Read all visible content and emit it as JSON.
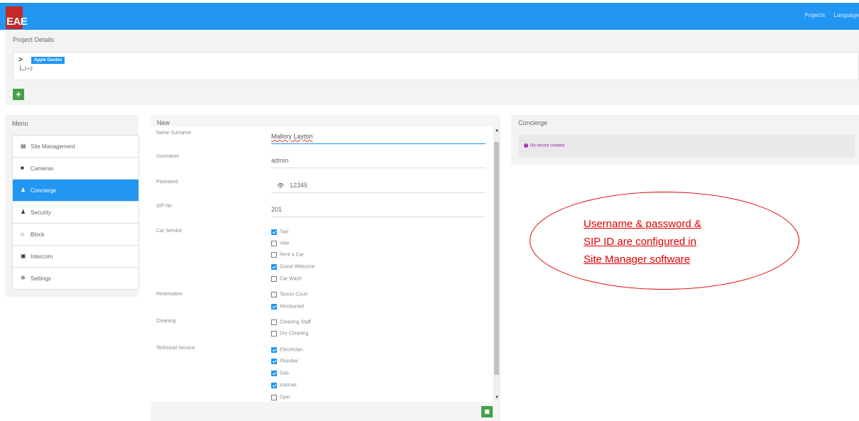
{
  "app": {
    "logo_text": "EAE",
    "nav": {
      "projects": "Projects",
      "language": "Language"
    }
  },
  "project_details": {
    "title": "Project Details",
    "tree": {
      "root": "Apple Garden",
      "child": "1+2"
    },
    "add_label": "+"
  },
  "menu": {
    "title": "Menu",
    "items": [
      {
        "label": "Site Management",
        "icon": "list-icon",
        "glyph": "▤",
        "active": false
      },
      {
        "label": "Cameras",
        "icon": "camera-icon",
        "glyph": "■",
        "active": false
      },
      {
        "label": "Concierge",
        "icon": "user-icon",
        "glyph": "♟",
        "active": true
      },
      {
        "label": "Security",
        "icon": "user-icon",
        "glyph": "♟",
        "active": false
      },
      {
        "label": "Block",
        "icon": "home-icon",
        "glyph": "⌂",
        "active": false
      },
      {
        "label": "Intercom",
        "icon": "intercom-icon",
        "glyph": "▣",
        "active": false
      },
      {
        "label": "Settings",
        "icon": "gear-icon",
        "glyph": "✲",
        "active": false
      }
    ]
  },
  "form": {
    "title": "New",
    "name_label": "Name Surname",
    "name_value": "Mallory Layton",
    "username_label": "Username",
    "username_value": "admin",
    "password_label": "Password",
    "password_value": "12345",
    "sip_label": "SIP No",
    "sip_value": "201",
    "car_service_label": "Car Service",
    "car_service": [
      {
        "label": "Taxi",
        "checked": true
      },
      {
        "label": "Vale",
        "checked": false
      },
      {
        "label": "Rent a Car",
        "checked": false
      },
      {
        "label": "Guest Welcome",
        "checked": true
      },
      {
        "label": "Car Wash",
        "checked": false
      }
    ],
    "reservation_label": "Reservation",
    "reservation": [
      {
        "label": "Tennis Court",
        "checked": false
      },
      {
        "label": "Restaurant",
        "checked": true
      }
    ],
    "cleaning_label": "Cleaning",
    "cleaning": [
      {
        "label": "Cleaning Staff",
        "checked": false
      },
      {
        "label": "Dry Cleaning",
        "checked": false
      }
    ],
    "technical_label": "Technical Service",
    "technical": [
      {
        "label": "Electrician",
        "checked": true
      },
      {
        "label": "Plumber",
        "checked": true
      },
      {
        "label": "Gas",
        "checked": true
      },
      {
        "label": "Internet",
        "checked": true
      },
      {
        "label": "Dyer",
        "checked": false
      }
    ]
  },
  "concierge": {
    "title": "Concierge",
    "empty_message": "No record created"
  },
  "annotation": {
    "lines": [
      "Username & password &",
      "SIP ID are configured in",
      "Site Manager software"
    ],
    "color": "#e00000"
  },
  "colors": {
    "primary": "#2196f3",
    "success": "#43a047",
    "logo": "#c62828"
  }
}
